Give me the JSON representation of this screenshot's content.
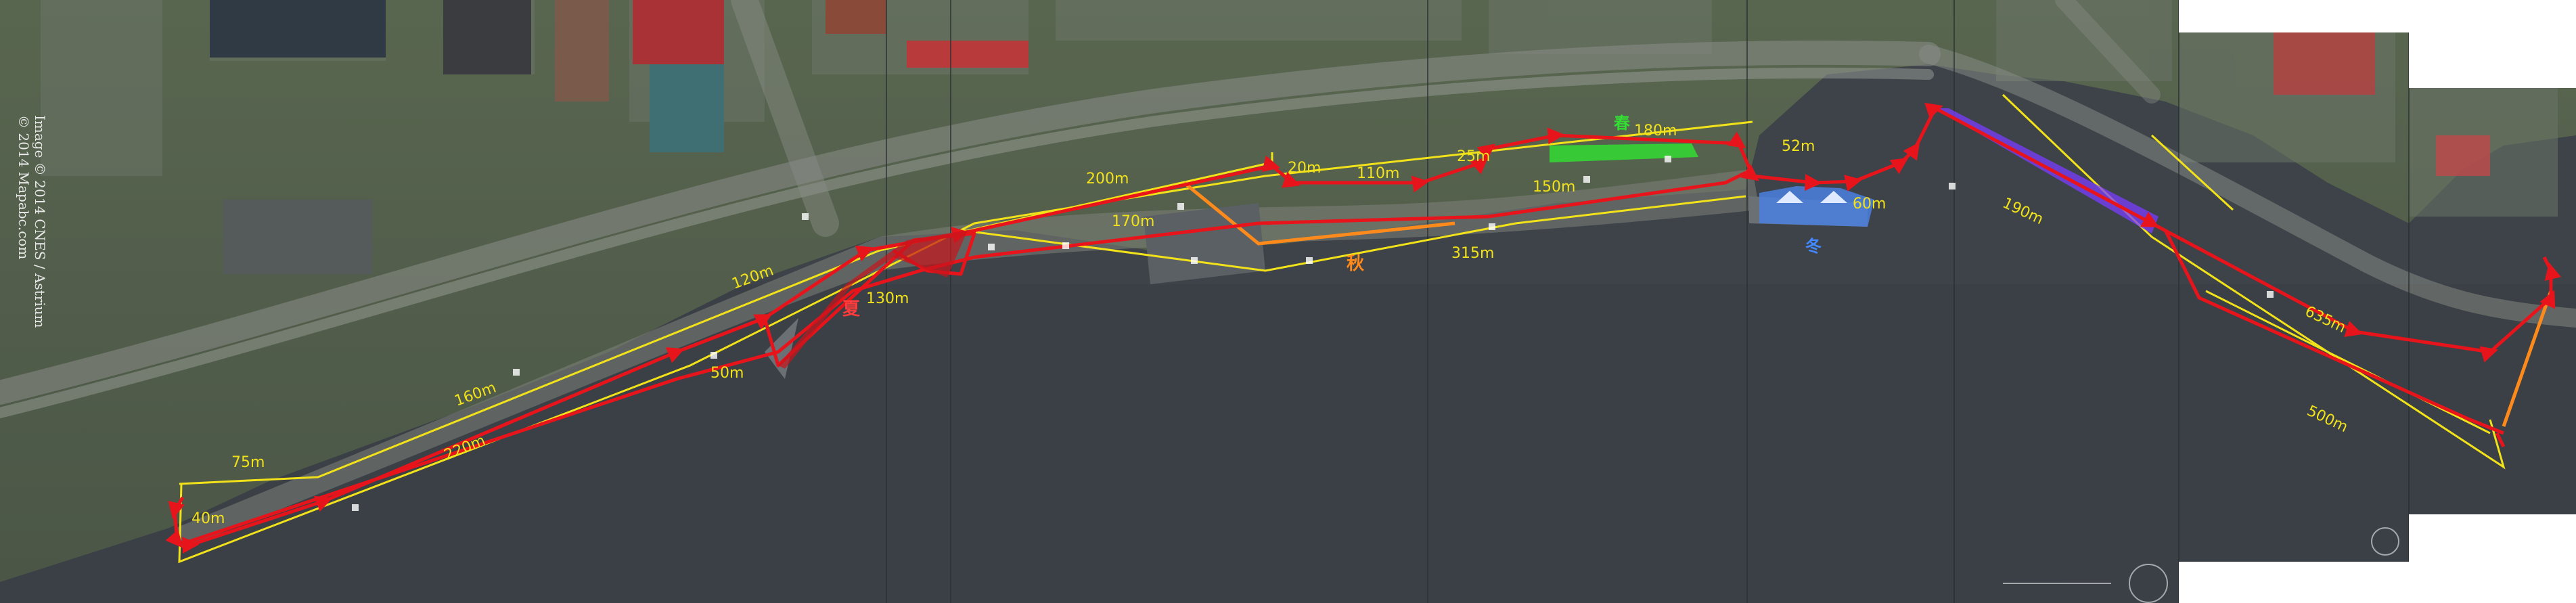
{
  "map": {
    "copyright": {
      "line1": "Image © 2014 CNES / Astrium",
      "line2": "© 2014 Mapabc.com"
    },
    "distance_labels": [
      "40m",
      "75m",
      "220m",
      "160m",
      "120m",
      "50m",
      "130m",
      "170m",
      "200m",
      "20m",
      "110m",
      "25m",
      "150m",
      "315m",
      "180m",
      "52m",
      "60m",
      "190m",
      "635m",
      "500m"
    ],
    "zone_labels": [
      {
        "text": "夏",
        "color": "#ff3b3b"
      },
      {
        "text": "秋",
        "color": "#ff8a1c"
      },
      {
        "text": "春",
        "color": "#33dd33"
      },
      {
        "text": "冬",
        "color": "#4488ff"
      }
    ],
    "route_colors": {
      "main_path": "#e8141b",
      "boundary": "#f2e21a",
      "autumn_segment": "#ff8a1c",
      "spring_segment": "#33dd33",
      "winter_segment": "#4a7fe0",
      "bridge_segment": "#7a3cff"
    }
  }
}
